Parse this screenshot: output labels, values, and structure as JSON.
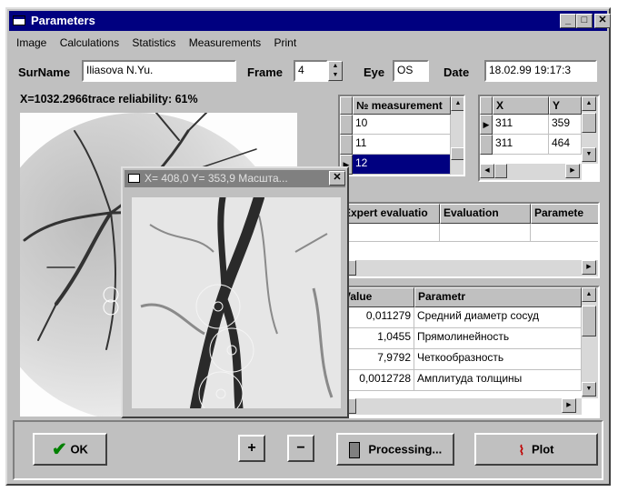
{
  "window": {
    "title": "Parameters"
  },
  "titlebar_buttons": {
    "minimize": "_",
    "maximize": "□",
    "close": "✕"
  },
  "menu": [
    "Image",
    "Calculations",
    "Statistics",
    "Measurements",
    "Print"
  ],
  "form": {
    "surname_label": "SurName",
    "surname_value": "Iliasova N.Yu.",
    "frame_label": "Frame",
    "frame_value": "4",
    "eye_label": "Eye",
    "eye_value": "OS",
    "date_label": "Date",
    "date_value": "18.02.99 19:17:3"
  },
  "info_text": "X=1032.2966trace reliability: 61%",
  "measurements": {
    "header": "№ measurement",
    "rows": [
      "10",
      "11",
      "12"
    ],
    "selected_index": 2
  },
  "points": {
    "headers": [
      "X",
      "Y"
    ],
    "rows": [
      [
        "311",
        "359"
      ],
      [
        "311",
        "464"
      ]
    ]
  },
  "expert": {
    "headers": [
      "Expert evaluatio",
      "Evaluation",
      "Paramete"
    ]
  },
  "params": {
    "headers": [
      "Value",
      "Parametr"
    ],
    "rows": [
      [
        "0,011279",
        "Средний диаметр сосуд"
      ],
      [
        "1,0455",
        "Прямолинейность"
      ],
      [
        "7,9792",
        "Четкообразность"
      ],
      [
        "0,0012728",
        "Амплитуда толщины"
      ]
    ]
  },
  "buttons": {
    "ok": "OK",
    "plus": "+",
    "minus": "−",
    "processing": "Processing...",
    "plot": "Plot"
  },
  "popup": {
    "title": "X= 408,0 Y= 353,9 Масшта...",
    "close": "✕"
  },
  "colors": {
    "titlebar": "#000080",
    "face": "#c0c0c0",
    "selection": "#000080",
    "ok_check": "#008000",
    "plot_icon": "#c00000"
  }
}
